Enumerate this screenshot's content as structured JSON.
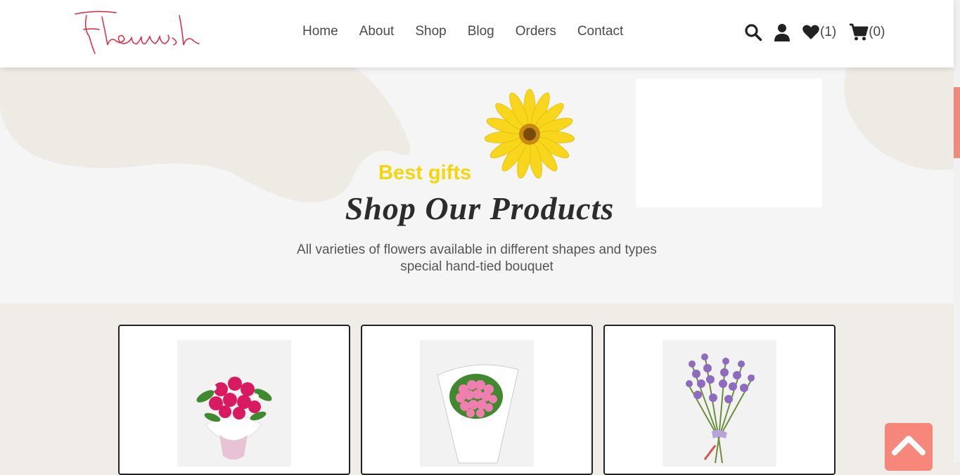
{
  "header": {
    "logo_text": "Flourish",
    "nav": [
      "Home",
      "About",
      "Shop",
      "Blog",
      "Orders",
      "Contact"
    ],
    "wishlist_count": "(1)",
    "cart_count": "(0)"
  },
  "hero": {
    "kicker": "Best gifts",
    "title": "Shop Our Products",
    "description_line1": "All varieties of flowers available in different shapes and types",
    "description_line2": "special hand-tied bouquet"
  },
  "products": [
    {
      "image": "pink-rose-bouquet"
    },
    {
      "image": "pink-ball-bouquet"
    },
    {
      "image": "purple-orchid-bundle"
    }
  ],
  "colors": {
    "accent_yellow": "#f5d50b",
    "logo_red": "#e0263f",
    "to_top_button": "#f6877a",
    "scrollbar_thumb": "#f08a7e"
  }
}
